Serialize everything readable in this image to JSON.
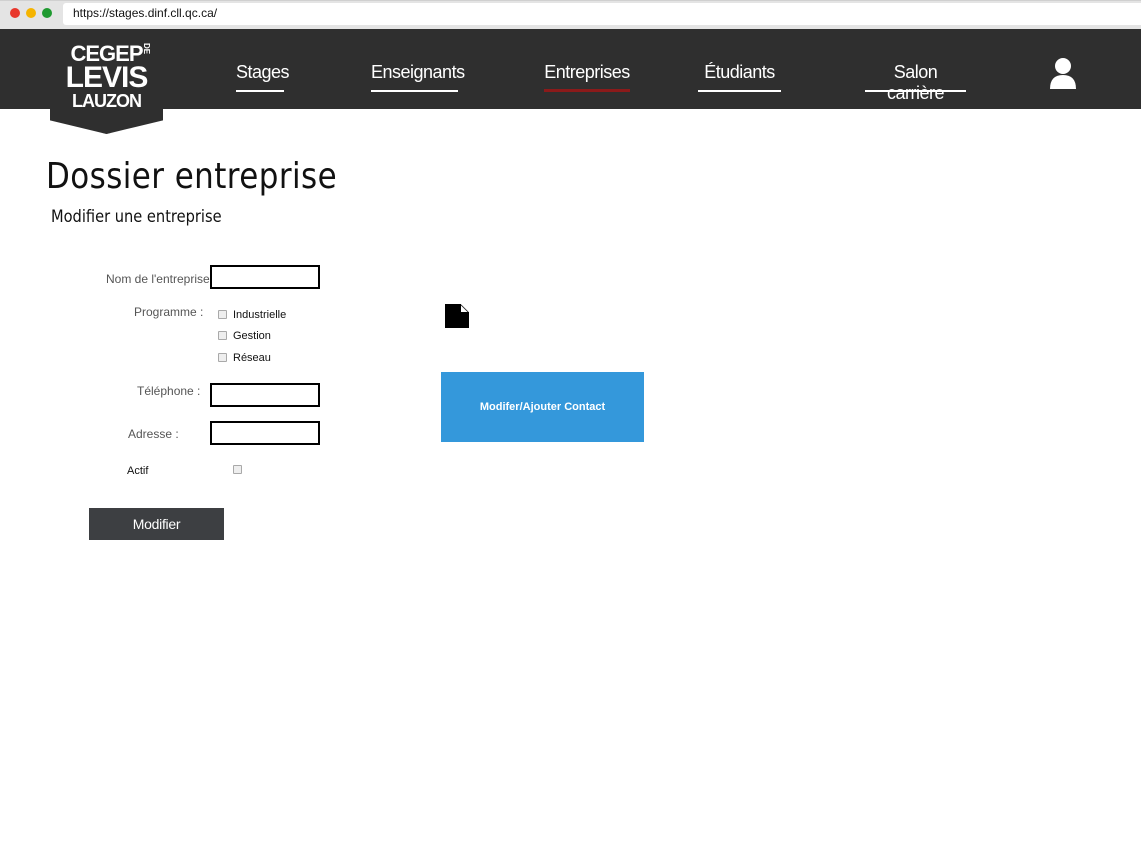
{
  "browser": {
    "url": "https://stages.dinf.cll.qc.ca/"
  },
  "logo": {
    "line1": "CEGEP",
    "de": "DE",
    "line2": "LEVIS",
    "line3": "LAUZON"
  },
  "nav": {
    "items": [
      {
        "label": "Stages",
        "active": false
      },
      {
        "label": "Enseignants",
        "active": false
      },
      {
        "label": "Entreprises",
        "active": true
      },
      {
        "label": "Étudiants",
        "active": false
      },
      {
        "label": "Salon carrière",
        "active": false
      }
    ],
    "user_icon": "user-icon"
  },
  "page": {
    "title": "Dossier entreprise",
    "subtitle": "Modifier une entreprise"
  },
  "form": {
    "name_label": "Nom de l'entreprise :",
    "name_value": "",
    "programme_label": "Programme :",
    "programmes": [
      {
        "label": "Industrielle",
        "checked": false
      },
      {
        "label": "Gestion",
        "checked": false
      },
      {
        "label": "Réseau",
        "checked": false
      }
    ],
    "phone_label": "Téléphone :",
    "phone_value": "",
    "address_label": "Adresse :",
    "address_value": "",
    "actif_label": "Actif",
    "actif_checked": false,
    "submit_label": "Modifier"
  },
  "side": {
    "doc_icon": "document-icon",
    "contact_button_label": "Modifer/Ajouter Contact",
    "contact_button_color": "#3498db"
  },
  "colors": {
    "navbar": "#2f2f2f",
    "active_underline": "#8b1a1a",
    "submit_button": "#3d3f42"
  }
}
